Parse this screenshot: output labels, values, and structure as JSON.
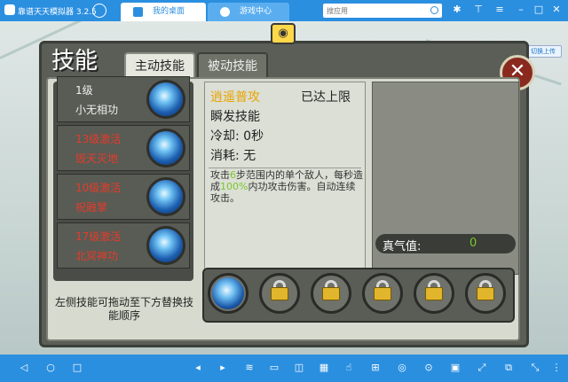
{
  "window": {
    "app_name": "靠谱天天模拟器 3.2.5",
    "tabs": [
      {
        "label": "我的桌面"
      },
      {
        "label": "游戏中心"
      }
    ],
    "search_placeholder": "搜应用",
    "switch_label": "切换上传"
  },
  "game": {
    "panel_title": "技能",
    "tabs": [
      {
        "label": "主动技能",
        "active": true
      },
      {
        "label": "被动技能",
        "active": false
      }
    ],
    "skills": [
      {
        "line1": "1级",
        "line2": "小无相功",
        "color": "white"
      },
      {
        "line1": "13级激活",
        "line2": "毁天灭地",
        "color": "red"
      },
      {
        "line1": "10级激活",
        "line2": "祝融掌",
        "color": "red"
      },
      {
        "line1": "17级激活",
        "line2": "北冥神功",
        "color": "red"
      }
    ],
    "hint": "左侧技能可拖动至下方替换技能顺序",
    "detail": {
      "name": "逍遥普攻",
      "limit": "已达上限",
      "type": "瞬发技能",
      "cooldown": "冷却: 0秒",
      "cost": "消耗: 无",
      "desc_part1": "攻击",
      "desc_num1": "6",
      "desc_part2": "步范围内的单个敌人，每秒造成",
      "desc_num2": "100%",
      "desc_part3": "内功攻击伤害。自动连续攻击。"
    },
    "qi": {
      "label": "真气值:",
      "value": "0"
    },
    "slots": [
      "skill",
      "locked",
      "locked",
      "locked",
      "locked",
      "locked"
    ]
  }
}
